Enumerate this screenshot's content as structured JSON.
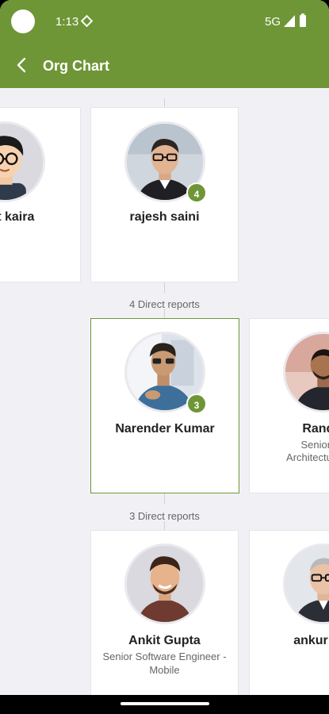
{
  "status": {
    "time": "1:13",
    "network": "5G"
  },
  "appbar": {
    "title": "Org Chart"
  },
  "managers": [
    {
      "name": "kant kaira"
    },
    {
      "name": "rajesh saini",
      "badge": "4"
    }
  ],
  "groups": [
    {
      "label": "4 Direct reports"
    },
    {
      "label": "3 Direct reports"
    }
  ],
  "reports_level1": [
    {
      "name": "Narender Kumar",
      "badge": "3"
    },
    {
      "name": "Randal",
      "role_line1": "Senior So",
      "role_line2": "Architecture & S"
    }
  ],
  "reports_level2": [
    {
      "name": "Ankit Gupta",
      "role": "Senior Software Engineer - Mobile"
    },
    {
      "name": "ankur kha"
    }
  ],
  "colors": {
    "brand": "#6e9636"
  }
}
